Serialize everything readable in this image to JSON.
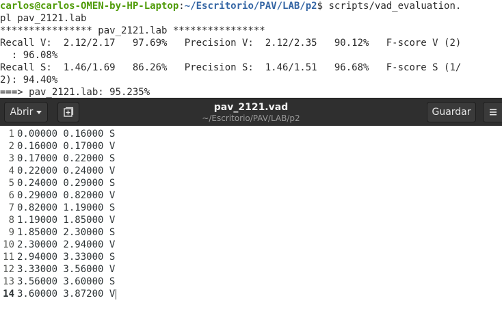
{
  "terminal": {
    "prompt_user": "carlos@carlos-OMEN-by-HP-Laptop",
    "prompt_sep": ":",
    "prompt_path": "~/Escritorio/PAV/LAB/p2",
    "prompt_symbol": "$ ",
    "command": "scripts/vad_evaluation.",
    "lines": [
      "pl pav_2121.lab",
      "**************** pav_2121.lab ****************",
      "Recall V:  2.12/2.17   97.69%   Precision V:  2.12/2.35   90.12%   F-score V (2)",
      "  : 96.08%",
      "Recall S:  1.46/1.69   86.26%   Precision S:  1.46/1.51   96.68%   F-score S (1/",
      "2): 94.40%",
      "===> pav_2121.lab: 95.235%"
    ]
  },
  "editor": {
    "open_label": "Abrir",
    "save_label": "Guardar",
    "title": "pav_2121.vad",
    "subtitle": "~/Escritorio/PAV/LAB/p2",
    "current_line": 14,
    "lines": [
      "0.00000 0.16000 S",
      "0.16000 0.17000 V",
      "0.17000 0.22000 S",
      "0.22000 0.24000 V",
      "0.24000 0.29000 S",
      "0.29000 0.82000 V",
      "0.82000 1.19000 S",
      "1.19000 1.85000 V",
      "1.85000 2.30000 S",
      "2.30000 2.94000 V",
      "2.94000 3.33000 S",
      "3.33000 3.56000 V",
      "3.56000 3.60000 S",
      "3.60000 3.87200 V"
    ]
  }
}
